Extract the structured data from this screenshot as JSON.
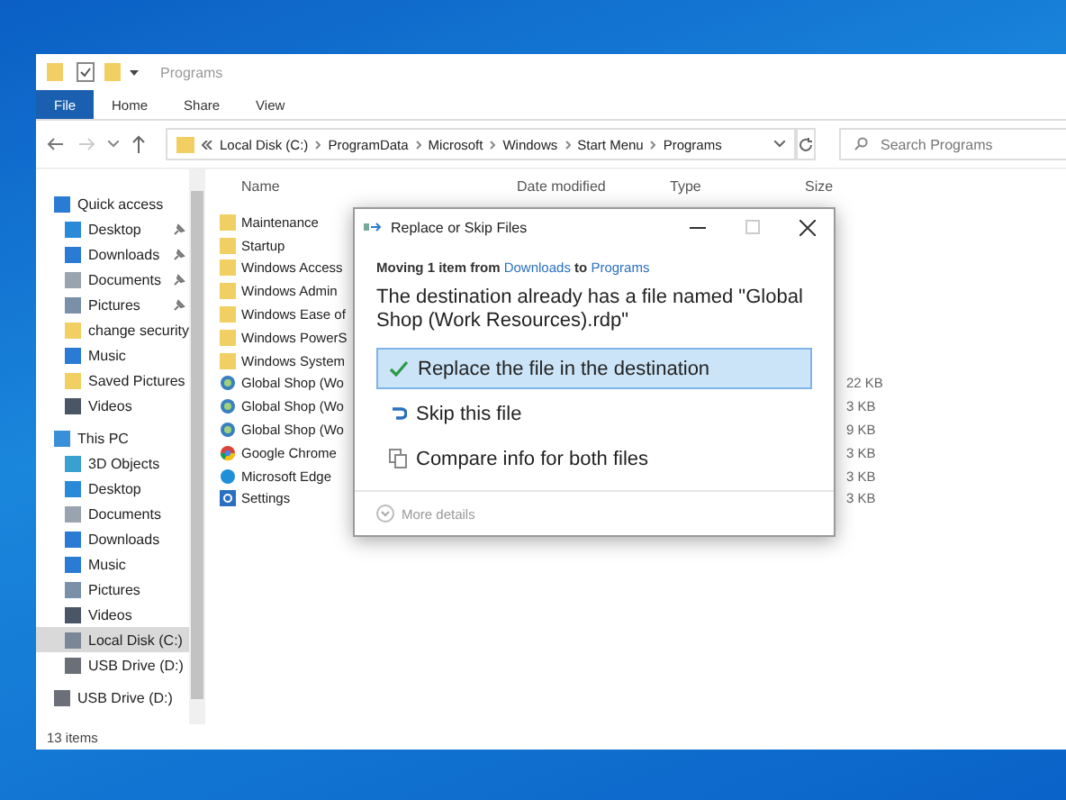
{
  "window": {
    "title": "Programs",
    "tabs": [
      {
        "label": "File",
        "selected": true
      },
      {
        "label": "Home",
        "selected": false
      },
      {
        "label": "Share",
        "selected": false
      },
      {
        "label": "View",
        "selected": false
      }
    ]
  },
  "address": {
    "crumbs": [
      "Local Disk (C:)",
      "ProgramData",
      "Microsoft",
      "Windows",
      "Start Menu",
      "Programs"
    ]
  },
  "search": {
    "placeholder": "Search Programs"
  },
  "nav": {
    "items": [
      {
        "label": "Quick access",
        "kind": "star",
        "selected": false,
        "children": [
          {
            "label": "Desktop",
            "kind": "desktop",
            "pinned": true,
            "selected": false
          },
          {
            "label": "Downloads",
            "kind": "download",
            "pinned": true,
            "selected": false
          },
          {
            "label": "Documents",
            "kind": "document",
            "pinned": true,
            "selected": false
          },
          {
            "label": "Pictures",
            "kind": "pictures",
            "pinned": true,
            "selected": false
          },
          {
            "label": "change security",
            "kind": "folder",
            "pinned": false,
            "selected": false
          },
          {
            "label": "Music",
            "kind": "music",
            "pinned": false,
            "selected": false
          },
          {
            "label": "Saved Pictures",
            "kind": "folder",
            "pinned": false,
            "selected": false
          },
          {
            "label": "Videos",
            "kind": "video",
            "pinned": false,
            "selected": false
          }
        ]
      },
      {
        "label": "This PC",
        "kind": "pc",
        "selected": false,
        "children": [
          {
            "label": "3D Objects",
            "kind": "cube",
            "pinned": false,
            "selected": false
          },
          {
            "label": "Desktop",
            "kind": "desktop",
            "pinned": false,
            "selected": false
          },
          {
            "label": "Documents",
            "kind": "document",
            "pinned": false,
            "selected": false
          },
          {
            "label": "Downloads",
            "kind": "download",
            "pinned": false,
            "selected": false
          },
          {
            "label": "Music",
            "kind": "music",
            "pinned": false,
            "selected": false
          },
          {
            "label": "Pictures",
            "kind": "pictures",
            "pinned": false,
            "selected": false
          },
          {
            "label": "Videos",
            "kind": "video",
            "pinned": false,
            "selected": false
          },
          {
            "label": "Local Disk (C:)",
            "kind": "disk",
            "pinned": false,
            "selected": true
          },
          {
            "label": "USB Drive (D:)",
            "kind": "usb",
            "pinned": false,
            "selected": false
          }
        ]
      },
      {
        "label": "USB Drive (D:)",
        "kind": "usb",
        "selected": false
      }
    ]
  },
  "files": {
    "columns": [
      "Name",
      "Date modified",
      "Type",
      "Size"
    ],
    "rows": [
      {
        "name": "Maintenance",
        "kind": "folder"
      },
      {
        "name": "Startup",
        "kind": "folder"
      },
      {
        "name": "Windows Access",
        "kind": "folder"
      },
      {
        "name": "Windows Admin",
        "kind": "folder"
      },
      {
        "name": "Windows Ease of",
        "kind": "folder"
      },
      {
        "name": "Windows PowerS",
        "kind": "folder"
      },
      {
        "name": "Windows System",
        "kind": "folder"
      },
      {
        "name": "Global Shop (Wo",
        "kind": "shortcut",
        "size": "22 KB"
      },
      {
        "name": "Global Shop (Wo",
        "kind": "shortcut",
        "size": "3 KB"
      },
      {
        "name": "Global Shop (Wo",
        "kind": "shortcut",
        "size": "9 KB"
      },
      {
        "name": "Google Chrome",
        "kind": "chrome",
        "size": "3 KB"
      },
      {
        "name": "Microsoft Edge",
        "kind": "edge",
        "size": "3 KB"
      },
      {
        "name": "Settings",
        "kind": "settings",
        "size": "3 KB"
      }
    ]
  },
  "status_bar": "13 items",
  "dialog": {
    "title": "Replace or Skip Files",
    "summary": {
      "prefix": "Moving 1 item from",
      "source": "Downloads",
      "middle": "to",
      "destination": "Programs"
    },
    "message": "The destination already has a file named \"Global Shop (Work Resources).rdp\"",
    "options": [
      {
        "label": "Replace the file in the destination",
        "kind": "replace",
        "selected": true
      },
      {
        "label": "Skip this file",
        "kind": "skip",
        "selected": false
      },
      {
        "label": "Compare info for both files",
        "kind": "compare",
        "selected": false
      }
    ],
    "more_details": "More details"
  }
}
